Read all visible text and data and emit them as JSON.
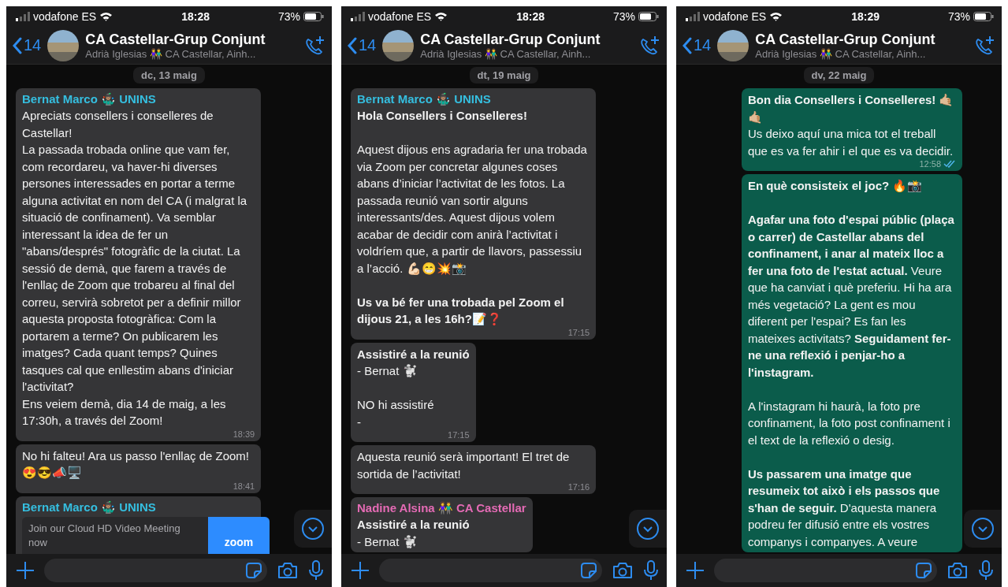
{
  "phones": [
    {
      "status": {
        "carrier": "vodafone ES",
        "time": "18:28",
        "battery": "73%"
      },
      "header": {
        "back_count": "14",
        "title": "CA Castellar-Grup Conjunt",
        "subtitle": "Adrià Iglesias 👫 CA Castellar, Ainh..."
      },
      "date": "dc, 13 maig",
      "messages": [
        {
          "kind": "text",
          "outgoing": false,
          "sender": "Bernat Marco 🤹🏽‍♂️ UNINS",
          "color": "#35bfe0",
          "body": "Apreciats consellers i conselleres de Castellar!\nLa passada trobada online que vam fer, com recordareu, va haver-hi diverses persones interessades en portar a terme alguna activitat en nom del CA (i malgrat la situació de confinament). Va semblar interessant la idea de fer un \"abans/després\" fotogràfic de la ciutat. La sessió de demà, que farem a través de l'enllaç de Zoom que trobareu al final del correu, servirà sobretot per a definir millor aquesta proposta fotogràfica: Com la portarem a terme? On publicarem les imatges? Cada quant temps? Quines tasques cal que enllestim abans d'iniciar l'activitat?\nEns veiem demà, dia 14 de maig, a les 17:30h, a través del Zoom!",
          "time": "18:39"
        },
        {
          "kind": "text",
          "outgoing": false,
          "body": "No hi falteu! Ara us passo l'enllaç de Zoom! 😍😎📣🖥️",
          "time": "18:41"
        },
        {
          "kind": "link",
          "outgoing": false,
          "sender": "Bernat Marco 🤹🏽‍♂️ UNINS",
          "color": "#35bfe0",
          "preview_title": "Join our Cloud HD Video Meeting now",
          "thumbnail": "zoom"
        }
      ]
    },
    {
      "status": {
        "carrier": "vodafone ES",
        "time": "18:28",
        "battery": "73%"
      },
      "header": {
        "back_count": "14",
        "title": "CA Castellar-Grup Conjunt",
        "subtitle": "Adrià Iglesias 👫 CA Castellar, Ainh..."
      },
      "date": "dt, 19 maig",
      "messages": [
        {
          "kind": "text",
          "outgoing": false,
          "sender": "Bernat Marco 🤹🏽‍♂️ UNINS",
          "color": "#35bfe0",
          "body": "**Hola Consellers i Conselleres!**\n\nAquest dijous ens agradaria fer una trobada via Zoom per concretar algunes coses abans d’iniciar l’activitat de les fotos. La passada reunió van sortir alguns interessants/des. Aquest dijous volem acabar de decidir com anirà l’activitat i voldríem que, a partir de llavors, passessiu a l’acció. 💪🏻😁💥📸\n\n**Us va bé fer una trobada pel Zoom el dijous 21, a les 16h?**📝❓",
          "time": "17:15"
        },
        {
          "kind": "text",
          "outgoing": false,
          "body": "**Assistiré a la reunió**\n- Bernat 🐩\n\nNO hi assistiré\n-",
          "time": "17:15"
        },
        {
          "kind": "text",
          "outgoing": false,
          "body": "Aquesta reunió serà important! El tret de sortida de l’activitat!",
          "time": "17:16"
        },
        {
          "kind": "text",
          "outgoing": false,
          "sender": "Nadine Alsina 👫 CA Castellar",
          "color": "#e56bb5",
          "body": "**Assistiré a la reunió**\n- Bernat 🐩"
        }
      ]
    },
    {
      "status": {
        "carrier": "vodafone ES",
        "time": "18:29",
        "battery": "73%"
      },
      "header": {
        "back_count": "14",
        "title": "CA Castellar-Grup Conjunt",
        "subtitle": "Adrià Iglesias 👫 CA Castellar, Ainh..."
      },
      "date": "dv, 22 maig",
      "messages": [
        {
          "kind": "text",
          "outgoing": true,
          "body": "**Bon dia Consellers i Conselleres! 🤙🏼🤙🏼**\nUs deixo aquí una mica tot el treball que es va fer ahir i el que es va decidir.",
          "time": "12:58",
          "read": true
        },
        {
          "kind": "text",
          "outgoing": true,
          "body": "**En què consisteix el joc? 🔥📸**\n\n**Agafar una foto d'espai públic (plaça o carrer) de Castellar abans del confinament, i anar al mateix lloc a fer una foto de l'estat actual.** Veure que ha canviat i què preferiu. Hi ha ara més vegetació? La gent es mou diferent per l'espai? Es fan les mateixes activitats? **Seguidament fer-ne una reflexió i penjar-ho a l'instagram.**\n\nA l'instagram hi haurà, la foto pre confinament, la foto post confinament i el text de la reflexió o desig.\n\n**Us passarem una imatge que resumeix tot això i els passos que s'han de seguir.** D'aquesta manera podreu fer difusió entre els vostres companys i companyes. A veure"
        }
      ]
    }
  ]
}
